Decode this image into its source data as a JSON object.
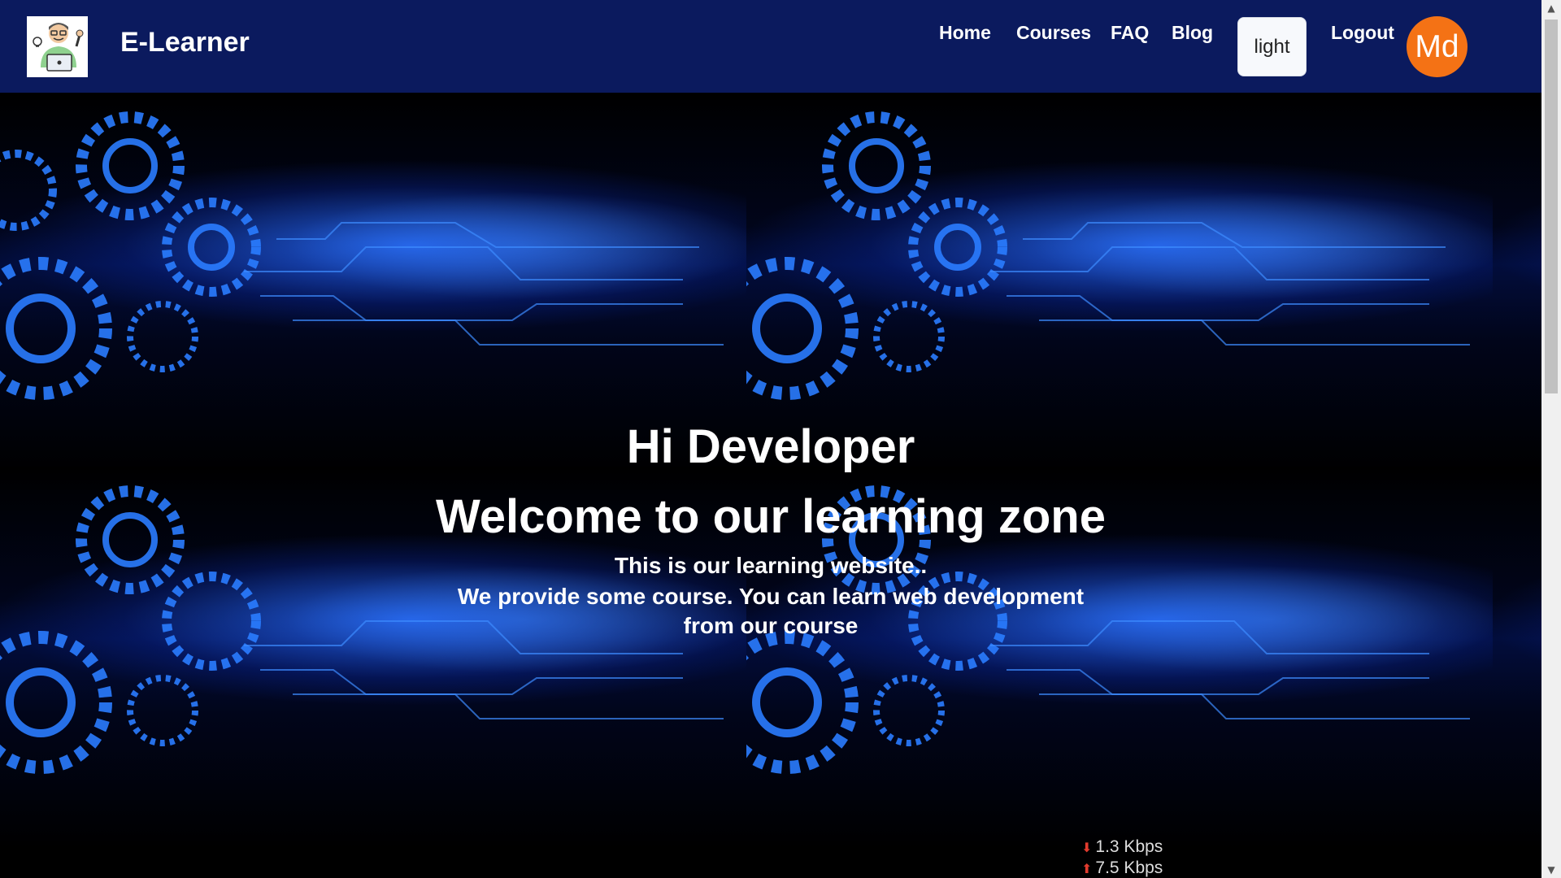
{
  "navbar": {
    "brand": "E-Learner",
    "links": [
      {
        "label": "Home"
      },
      {
        "label": "Courses"
      },
      {
        "label": "FAQ"
      },
      {
        "label": "Blog"
      }
    ],
    "theme_button": "light",
    "logout": "Logout",
    "avatar": "Md"
  },
  "hero": {
    "greeting": "Hi Developer",
    "headline": "Welcome to our learning zone",
    "line1": "This is our learning website..",
    "line2": "We provide some course. You can learn web development",
    "line3": "from our course"
  },
  "speed": {
    "down": "1.3 Kbps",
    "up": "7.5 Kbps"
  },
  "colors": {
    "navbar": "#0b1a5e",
    "avatar": "#f47215",
    "background": "#000000"
  }
}
